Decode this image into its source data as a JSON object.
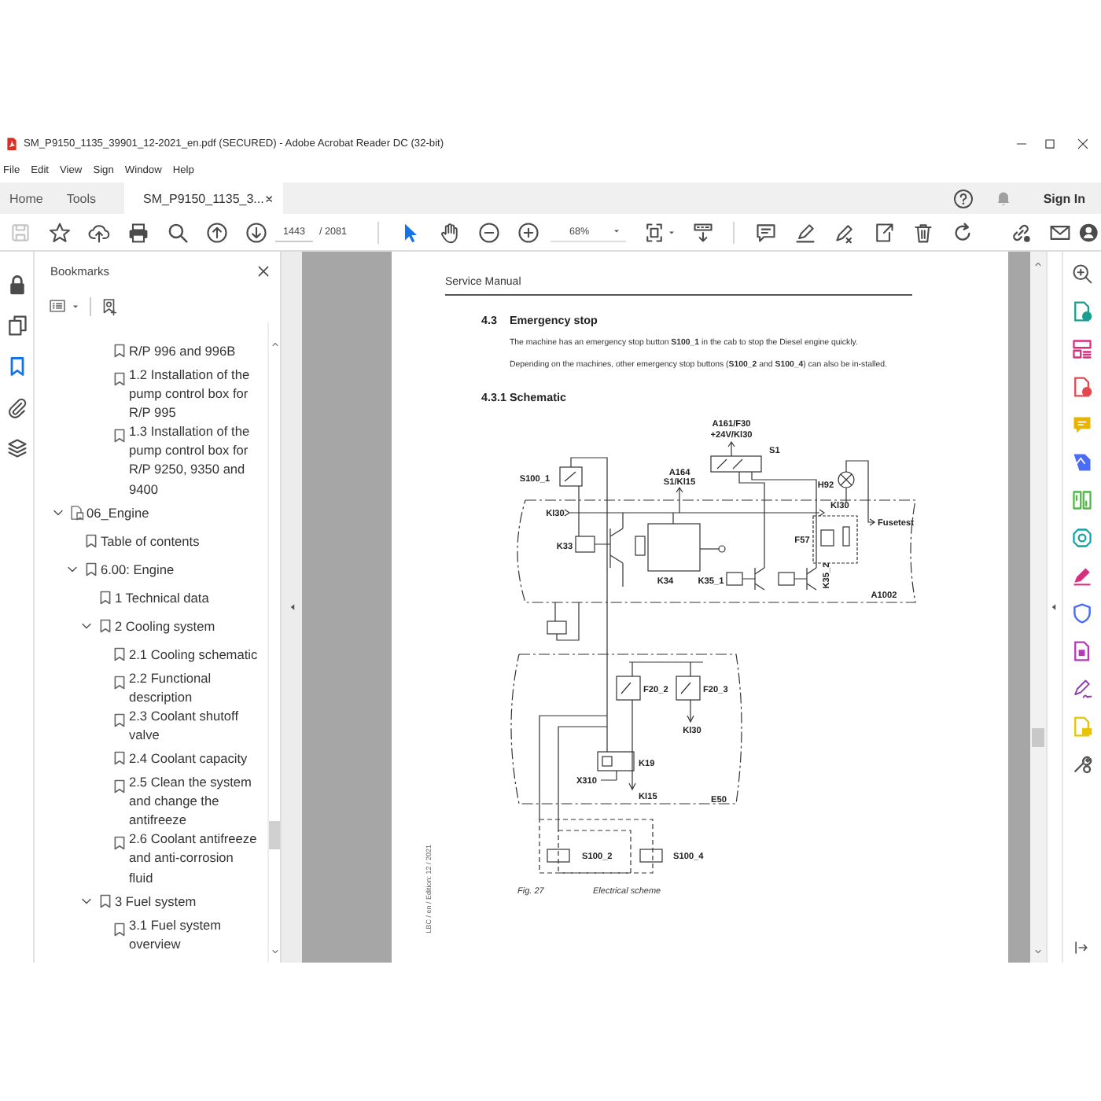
{
  "window": {
    "title": "SM_P9150_1135_39901_12-2021_en.pdf (SECURED) - Adobe Acrobat Reader DC (32-bit)"
  },
  "menu": [
    "File",
    "Edit",
    "View",
    "Sign",
    "Window",
    "Help"
  ],
  "tabs": [
    {
      "label": "Home",
      "selected": false,
      "closable": false
    },
    {
      "label": "Tools",
      "selected": false,
      "closable": false
    },
    {
      "label": "SM_P9150_1135_3...",
      "selected": true,
      "closable": true
    }
  ],
  "sign_in": "Sign In",
  "toolbar": {
    "save_disabled": true,
    "page": "1443",
    "page_count": "/ 2081",
    "zoom": "68%"
  },
  "left_rail": [
    {
      "kind": "lock",
      "selected": false
    },
    {
      "kind": "pages",
      "selected": false
    },
    {
      "kind": "bookmarks",
      "selected": true
    },
    {
      "kind": "attachments",
      "selected": false
    },
    {
      "kind": "layers",
      "selected": false
    }
  ],
  "bookmarks": {
    "title": "Bookmarks",
    "tree": [
      {
        "children": [
          {
            "children": [
              {
                "children": [
                  {
                    "label": "R/P 996 and 996B",
                    "kind": "bookmark"
                  },
                  {
                    "label": "1.2 Installation of the pump control box for R/P 995",
                    "kind": "bookmark"
                  },
                  {
                    "label": "1.3 Installation of the pump control box for R/P 9250, 9350 and 9400",
                    "kind": "bookmark"
                  }
                ]
              }
            ]
          }
        ]
      },
      {
        "label": "06_Engine",
        "kind": "file",
        "expanded": true,
        "children": [
          {
            "label": "Table of contents",
            "kind": "bookmark"
          },
          {
            "label": "6.00: Engine",
            "kind": "bookmark",
            "expanded": true,
            "children": [
              {
                "label": "1 Technical data",
                "kind": "bookmark"
              },
              {
                "label": "2 Cooling system",
                "kind": "bookmark",
                "expanded": true,
                "children": [
                  {
                    "label": "2.1 Cooling schematic",
                    "kind": "bookmark"
                  },
                  {
                    "label": "2.2 Functional description",
                    "kind": "bookmark"
                  },
                  {
                    "label": "2.3 Coolant shutoff valve",
                    "kind": "bookmark"
                  },
                  {
                    "label": "2.4 Coolant capacity",
                    "kind": "bookmark"
                  },
                  {
                    "label": "2.5 Clean the system and change the antifreeze",
                    "kind": "bookmark"
                  },
                  {
                    "label": "2.6 Coolant antifreeze and anti-corrosion fluid",
                    "kind": "bookmark"
                  }
                ]
              },
              {
                "label": "3 Fuel system",
                "kind": "bookmark",
                "expanded": true,
                "children": [
                  {
                    "label": "3.1 Fuel system overview",
                    "kind": "bookmark"
                  }
                ]
              }
            ]
          }
        ]
      }
    ]
  },
  "page": {
    "header": "Service Manual",
    "section_number": "4.3",
    "section_title": "Emergency stop",
    "paragraphs": [
      "The machine has an emergency stop button **S100_1** in the cab to stop the Diesel engine quickly.",
      "Depending on the machines, other emergency stop buttons (**S100_2** and **S100_4**) can also be in-stalled."
    ],
    "subsection_number": "4.3.1",
    "subsection_title": "Schematic",
    "schematic": {
      "labels": [
        "A161/F30",
        "+24V/Kl30",
        "S1",
        "S100_1",
        "A164",
        "S1/Kl15",
        "H92",
        "Kl30",
        "Kl30",
        "Fusetest",
        "K33",
        "F57",
        "K34",
        "K35_1",
        "K35_2",
        "A1002",
        "F20_2",
        "F20_3",
        "Kl30",
        "K19",
        "X310",
        "Kl15",
        "E50",
        "S100_2",
        "S100_4"
      ]
    },
    "figure_number": "Fig. 27",
    "figure_caption": "Electrical scheme",
    "edition_note": "LBC / en / Edition: 12 / 2021"
  }
}
